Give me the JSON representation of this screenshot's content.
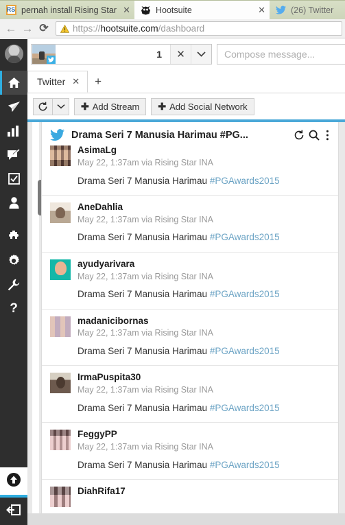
{
  "browser": {
    "tabs": [
      {
        "title": "pernah install Rising Star",
        "favicon": "rising-star-icon",
        "active": false,
        "close_label": "✕"
      },
      {
        "title": "Hootsuite",
        "favicon": "hootsuite-owl-icon",
        "active": true,
        "close_label": "✕"
      },
      {
        "title": "(26) Twitter",
        "favicon": "twitter-bird-icon",
        "active": false,
        "close_label": ""
      }
    ],
    "nav": {
      "back": "←",
      "forward": "→",
      "reload": "⟳"
    },
    "omnibox": {
      "scheme": "https://",
      "host": "hootsuite.com",
      "path": "/dashboard",
      "full_url": "https://hootsuite.com/dashboard",
      "security_icon": "warning-triangle-icon"
    }
  },
  "app": {
    "topbar": {
      "avatar_name": "user-avatar",
      "profile_picker": {
        "count": "1",
        "clear_label": "✕",
        "caret_label": "⌄",
        "network_badge": "twitter-icon"
      },
      "compose_placeholder": "Compose message...",
      "compose_value": ""
    },
    "leftnav": {
      "items": [
        {
          "name": "home",
          "icon": "home-icon",
          "active": true
        },
        {
          "name": "publisher",
          "icon": "paper-plane-icon",
          "active": false
        },
        {
          "name": "analytics",
          "icon": "bar-chart-icon",
          "active": false
        },
        {
          "name": "promote",
          "icon": "megaphone-icon",
          "active": false
        },
        {
          "name": "assignments",
          "icon": "checkbox-icon",
          "active": false
        },
        {
          "name": "contacts",
          "icon": "person-icon",
          "active": false
        },
        {
          "name": "app-directory",
          "icon": "puzzle-piece-icon",
          "active": false
        },
        {
          "name": "settings",
          "icon": "gear-icon",
          "active": false
        },
        {
          "name": "tools",
          "icon": "wrench-icon",
          "active": false
        },
        {
          "name": "help",
          "icon": "question-mark-icon",
          "active": false
        }
      ],
      "bottom": [
        {
          "name": "upgrade",
          "icon": "arrow-up-circle-icon"
        },
        {
          "name": "sign-out",
          "icon": "logout-icon"
        }
      ]
    },
    "tabs": [
      {
        "label": "Twitter",
        "active": true,
        "close_label": "✕"
      }
    ],
    "add_tab_label": "+",
    "toolbar": {
      "refresh_icon": "refresh-icon",
      "refresh_caret": "⌄",
      "add_stream_label": "Add Stream",
      "add_social_network_label": "Add Social Network",
      "plus_glyph": "✚"
    },
    "stream": {
      "network_icon": "twitter-bird-icon",
      "title": "Drama Seri 7 Manusia Harimau #PG...",
      "actions": [
        {
          "name": "refresh-stream",
          "icon": "refresh-icon",
          "glyph": "⟳"
        },
        {
          "name": "search-stream",
          "icon": "search-icon",
          "glyph": "⌕"
        },
        {
          "name": "stream-options",
          "icon": "kebab-menu-icon",
          "glyph": "⋮"
        }
      ],
      "tweets": [
        {
          "username": "AsimaLg",
          "timestamp": "May 22, 1:37am via Rising Star INA",
          "text": "Drama Seri 7 Manusia Harimau ",
          "hashtag": "#PGAwards2015",
          "avatar": "av1"
        },
        {
          "username": "AneDahlia",
          "timestamp": "May 22, 1:37am via Rising Star INA",
          "text": "Drama Seri 7 Manusia Harimau ",
          "hashtag": "#PGAwards2015",
          "avatar": "av2"
        },
        {
          "username": "ayudyarivara",
          "timestamp": "May 22, 1:37am via Rising Star INA",
          "text": "Drama Seri 7 Manusia Harimau ",
          "hashtag": "#PGAwards2015",
          "avatar": "av3"
        },
        {
          "username": "madanicibornas",
          "timestamp": "May 22, 1:37am via Rising Star INA",
          "text": "Drama Seri 7 Manusia Harimau ",
          "hashtag": "#PGAwards2015",
          "avatar": "av4"
        },
        {
          "username": "IrmaPuspita30",
          "timestamp": "May 22, 1:37am via Rising Star INA",
          "text": "Drama Seri 7 Manusia Harimau ",
          "hashtag": "#PGAwards2015",
          "avatar": "av5"
        },
        {
          "username": "FeggyPP",
          "timestamp": "May 22, 1:37am via Rising Star INA",
          "text": "Drama Seri 7 Manusia Harimau ",
          "hashtag": "#PGAwards2015",
          "avatar": "av6"
        },
        {
          "username": "DiahRifa17",
          "timestamp": "",
          "text": "",
          "hashtag": "",
          "avatar": "av7"
        }
      ]
    }
  },
  "colors": {
    "accent_blue": "#2faee0",
    "stream_divider_blue": "#4aa8d8",
    "hashtag_blue": "#6ba3c4",
    "nav_dark": "#2e2e2e",
    "chrome_tabstrip": "#b4bd9b"
  }
}
